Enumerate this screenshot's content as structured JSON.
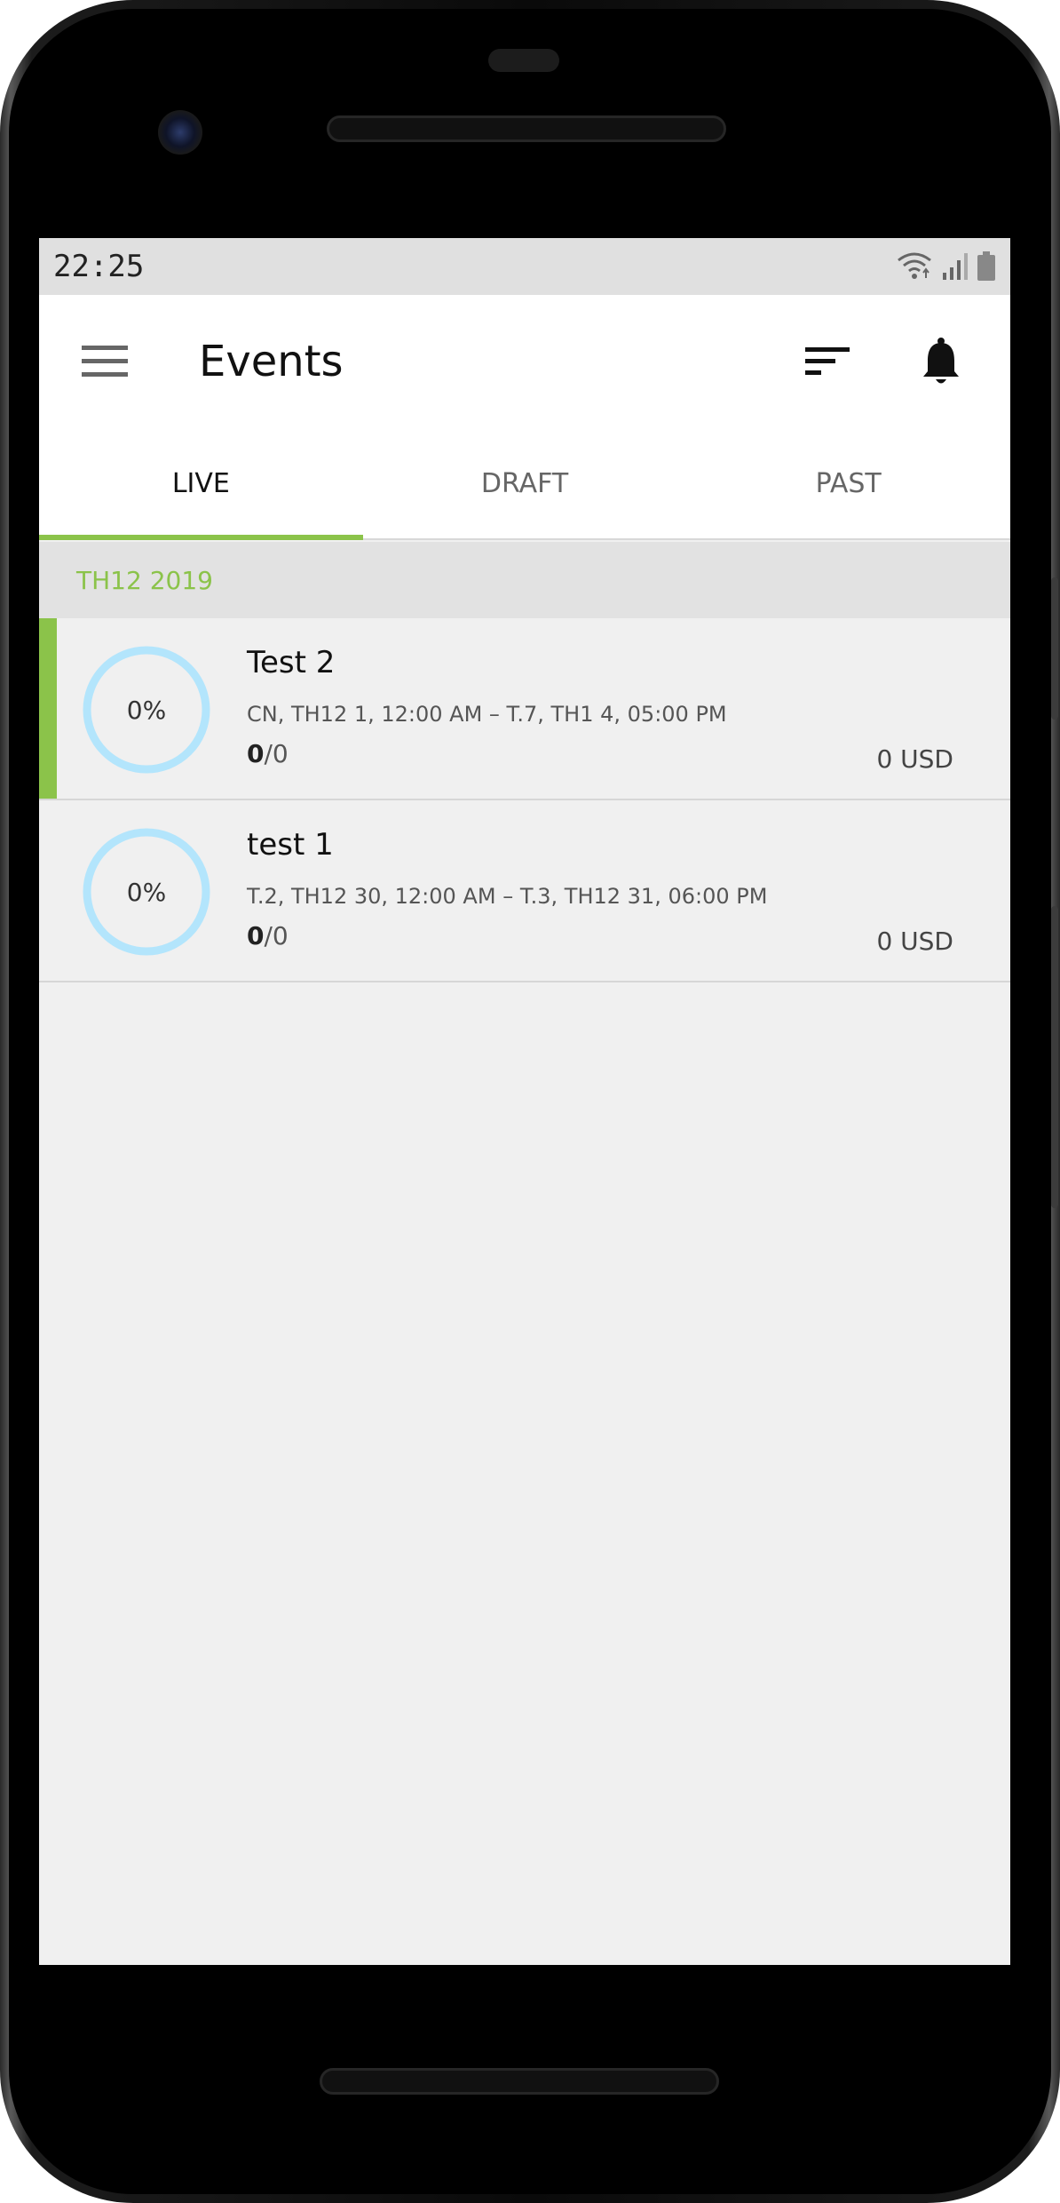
{
  "status_bar": {
    "time": "22:25"
  },
  "app_bar": {
    "title": "Events",
    "icons": [
      "menu-icon",
      "sort-icon",
      "bell-icon"
    ]
  },
  "tabs": [
    {
      "label": "LIVE",
      "active": true
    },
    {
      "label": "DRAFT",
      "active": false
    },
    {
      "label": "PAST",
      "active": false
    }
  ],
  "section": {
    "label": "TH12 2019"
  },
  "events": [
    {
      "name": "Test 2",
      "dates": "CN, TH12 1, 12:00 AM – T.7, TH1 4, 05:00 PM",
      "sold": "0",
      "total": "/0",
      "price": "0 USD",
      "progress_label": "0%",
      "progress": 0,
      "highlighted": true
    },
    {
      "name": "test 1",
      "dates": "T.2, TH12 30, 12:00 AM – T.3, TH12 31, 06:00 PM",
      "sold": "0",
      "total": "/0",
      "price": "0 USD",
      "progress_label": "0%",
      "progress": 0,
      "highlighted": false
    }
  ],
  "colors": {
    "accent": "#8bc34a",
    "ring": "#b3e5fc",
    "section_bg": "#e2e2e2",
    "list_bg": "#f0f0f0"
  }
}
